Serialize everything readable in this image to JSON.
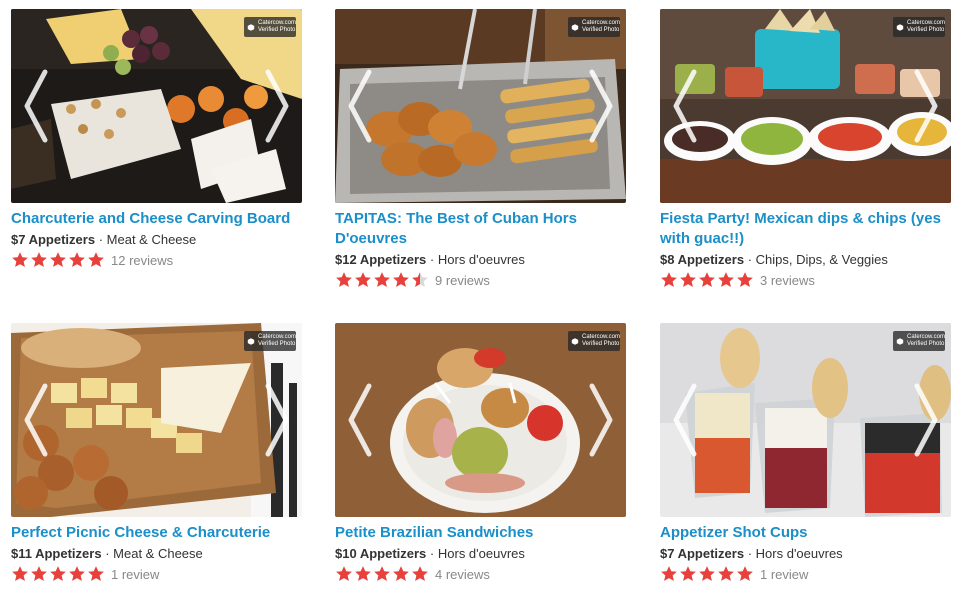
{
  "badge": {
    "line1": "Catercow.com",
    "line2": "Verified Photo"
  },
  "colors": {
    "title": "#1a8fc9",
    "star": "#e8413c",
    "star_empty": "#d8d8d8"
  },
  "listings": [
    {
      "title_line1": "Charcuterie and Cheese Carving Board",
      "title_line2": "",
      "price": "$7 Appetizers",
      "separator": "·",
      "category": "Meat & Cheese",
      "rating": 5,
      "reviews": "12 reviews",
      "photo_icon": "cheese-board-photo"
    },
    {
      "title_line1": "TAPITAS: The Best of Cuban Hors",
      "title_line2": "D'oeuvres",
      "price": "$12 Appetizers",
      "separator": "·",
      "category": "Hors d'oeuvres",
      "rating": 4.5,
      "reviews": "9 reviews",
      "photo_icon": "empanada-tray-photo"
    },
    {
      "title_line1": "Fiesta Party! Mexican dips & chips (yes",
      "title_line2": "with guac!!)",
      "price": "$8 Appetizers",
      "separator": "·",
      "category": "Chips, Dips, & Veggies",
      "rating": 5,
      "reviews": "3 reviews",
      "photo_icon": "dips-and-chips-photo"
    },
    {
      "title_line1": "Perfect Picnic Cheese & Charcuterie",
      "title_line2": "",
      "price": "$11 Appetizers",
      "separator": "·",
      "category": "Meat & Cheese",
      "rating": 5,
      "reviews": "1 review",
      "photo_icon": "picnic-cheese-photo"
    },
    {
      "title_line1": "Petite Brazilian Sandwiches",
      "title_line2": "",
      "price": "$10 Appetizers",
      "separator": "·",
      "category": "Hors d'oeuvres",
      "rating": 5,
      "reviews": "4 reviews",
      "photo_icon": "mini-sandwiches-photo"
    },
    {
      "title_line1": "Appetizer Shot Cups",
      "title_line2": "",
      "price": "$7 Appetizers",
      "separator": "·",
      "category": "Hors d'oeuvres",
      "rating": 5,
      "reviews": "1 review",
      "photo_icon": "shot-cups-photo"
    }
  ]
}
